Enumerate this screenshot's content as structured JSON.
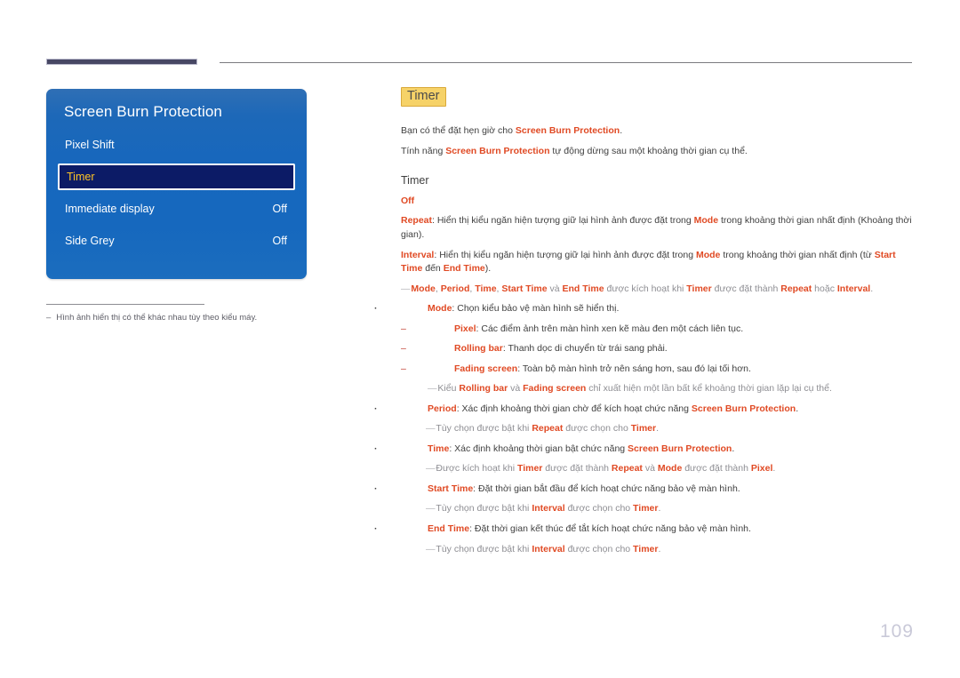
{
  "page": {
    "number": "109"
  },
  "header": {
    "rule_color": "#474764",
    "thin_rule_color": "#7a7a7f"
  },
  "osd": {
    "title": "Screen Burn Protection",
    "rows": [
      {
        "label": "Pixel Shift",
        "value": ""
      },
      {
        "label": "Timer",
        "value": "",
        "selected": true
      },
      {
        "label": "Immediate display",
        "value": "Off"
      },
      {
        "label": "Side Grey",
        "value": "Off"
      }
    ],
    "footnote_dash": "–",
    "footnote": "Hình ảnh hiển thị có thể khác nhau tùy theo kiểu máy.",
    "accent_selected_text": "#ffc425",
    "panel_blue": "#1767bd",
    "selected_bg": "#0c1b66"
  },
  "content": {
    "title_badge": "Timer",
    "intro": [
      {
        "parts": [
          {
            "t": "Bạn có thể đặt hẹn giờ cho ",
            "s": "n"
          },
          {
            "t": "Screen Burn Protection",
            "s": "k"
          },
          {
            "t": ".",
            "s": "n"
          }
        ]
      },
      {
        "parts": [
          {
            "t": "Tính năng ",
            "s": "n"
          },
          {
            "t": "Screen Burn Protection",
            "s": "k"
          },
          {
            "t": " tự động dừng sau một khoảng thời gian cụ thể.",
            "s": "n"
          }
        ]
      }
    ],
    "sub_heading": "Timer",
    "lines": [
      {
        "level": "plain",
        "parts": [
          {
            "t": "Off",
            "s": "k"
          }
        ]
      },
      {
        "level": "plain",
        "parts": [
          {
            "t": "Repeat",
            "s": "k"
          },
          {
            "t": ": Hiển thị kiểu ngăn hiện tượng giữ lại hình ảnh được đặt trong ",
            "s": "n"
          },
          {
            "t": "Mode",
            "s": "k"
          },
          {
            "t": " trong khoảng thời gian nhất định (Khoảng thời gian).",
            "s": "n"
          }
        ]
      },
      {
        "level": "plain",
        "parts": [
          {
            "t": "Interval",
            "s": "k"
          },
          {
            "t": ": Hiển thị kiểu ngăn hiện tượng giữ lại hình ảnh được đặt trong ",
            "s": "n"
          },
          {
            "t": "Mode",
            "s": "k"
          },
          {
            "t": " trong khoảng thời gian nhất định (từ ",
            "s": "n"
          },
          {
            "t": "Start Time",
            "s": "k"
          },
          {
            "t": " đến ",
            "s": "n"
          },
          {
            "t": "End Time",
            "s": "k"
          },
          {
            "t": ").",
            "s": "n"
          }
        ]
      },
      {
        "level": "note",
        "parts": [
          {
            "t": "Mode",
            "s": "k"
          },
          {
            "t": ", ",
            "s": "m"
          },
          {
            "t": "Period",
            "s": "k"
          },
          {
            "t": ", ",
            "s": "m"
          },
          {
            "t": "Time",
            "s": "k"
          },
          {
            "t": ", ",
            "s": "m"
          },
          {
            "t": "Start Time",
            "s": "k"
          },
          {
            "t": " và ",
            "s": "m"
          },
          {
            "t": "End Time",
            "s": "k"
          },
          {
            "t": " được kích hoạt khi ",
            "s": "m"
          },
          {
            "t": "Timer",
            "s": "k"
          },
          {
            "t": " được đặt thành ",
            "s": "m"
          },
          {
            "t": "Repeat",
            "s": "k"
          },
          {
            "t": " hoặc ",
            "s": "m"
          },
          {
            "t": "Interval",
            "s": "k"
          },
          {
            "t": ".",
            "s": "m"
          }
        ]
      },
      {
        "level": "bullet",
        "parts": [
          {
            "t": "Mode",
            "s": "k"
          },
          {
            "t": ": Chọn kiểu bảo vệ màn hình sẽ hiển thị.",
            "s": "n"
          }
        ]
      },
      {
        "level": "dash",
        "parts": [
          {
            "t": "Pixel",
            "s": "k"
          },
          {
            "t": ": Các điểm ảnh trên màn hình xen kẽ màu đen một cách liên tục.",
            "s": "n"
          }
        ]
      },
      {
        "level": "dash",
        "parts": [
          {
            "t": "Rolling bar",
            "s": "k"
          },
          {
            "t": ": Thanh dọc di chuyển từ trái sang phải.",
            "s": "n"
          }
        ]
      },
      {
        "level": "dash",
        "parts": [
          {
            "t": "Fading screen",
            "s": "k"
          },
          {
            "t": ": Toàn bộ màn hình trở nên sáng hơn, sau đó lại tối hơn.",
            "s": "n"
          }
        ]
      },
      {
        "level": "note2",
        "parts": [
          {
            "t": "Kiểu ",
            "s": "m"
          },
          {
            "t": "Rolling bar",
            "s": "k"
          },
          {
            "t": " và ",
            "s": "m"
          },
          {
            "t": "Fading screen",
            "s": "k"
          },
          {
            "t": " chỉ xuất hiện một lần bất kể khoảng thời gian lặp lại cụ thể.",
            "s": "m"
          }
        ]
      },
      {
        "level": "bullet",
        "parts": [
          {
            "t": "Period",
            "s": "k"
          },
          {
            "t": ": Xác định khoảng thời gian chờ để kích hoạt chức năng ",
            "s": "n"
          },
          {
            "t": "Screen Burn Protection",
            "s": "k"
          },
          {
            "t": ".",
            "s": "n"
          }
        ]
      },
      {
        "level": "note3",
        "parts": [
          {
            "t": "Tùy chọn được bật khi ",
            "s": "m"
          },
          {
            "t": "Repeat",
            "s": "k"
          },
          {
            "t": " được chọn cho ",
            "s": "m"
          },
          {
            "t": "Timer",
            "s": "k"
          },
          {
            "t": ".",
            "s": "m"
          }
        ]
      },
      {
        "level": "bullet",
        "parts": [
          {
            "t": "Time",
            "s": "k"
          },
          {
            "t": ": Xác định khoảng thời gian bật chức năng ",
            "s": "n"
          },
          {
            "t": "Screen Burn Protection",
            "s": "k"
          },
          {
            "t": ".",
            "s": "n"
          }
        ]
      },
      {
        "level": "note3",
        "parts": [
          {
            "t": "Được kích hoạt khi ",
            "s": "m"
          },
          {
            "t": "Timer",
            "s": "k"
          },
          {
            "t": " được đặt thành ",
            "s": "m"
          },
          {
            "t": "Repeat",
            "s": "k"
          },
          {
            "t": " và ",
            "s": "m"
          },
          {
            "t": "Mode",
            "s": "k"
          },
          {
            "t": " được đặt thành ",
            "s": "m"
          },
          {
            "t": "Pixel",
            "s": "k"
          },
          {
            "t": ".",
            "s": "m"
          }
        ]
      },
      {
        "level": "bullet",
        "parts": [
          {
            "t": "Start Time",
            "s": "k"
          },
          {
            "t": ": Đặt thời gian bắt đầu để kích hoạt chức năng bảo vệ màn hình.",
            "s": "n"
          }
        ]
      },
      {
        "level": "note3",
        "parts": [
          {
            "t": "Tùy chọn được bật khi ",
            "s": "m"
          },
          {
            "t": "Interval",
            "s": "k"
          },
          {
            "t": " được chọn cho ",
            "s": "m"
          },
          {
            "t": "Timer",
            "s": "k"
          },
          {
            "t": ".",
            "s": "m"
          }
        ]
      },
      {
        "level": "bullet",
        "parts": [
          {
            "t": "End Time",
            "s": "k"
          },
          {
            "t": ": Đặt thời gian kết thúc để tắt kích hoạt chức năng bảo vệ màn hình.",
            "s": "n"
          }
        ]
      },
      {
        "level": "note3",
        "parts": [
          {
            "t": "Tùy chọn được bật khi ",
            "s": "m"
          },
          {
            "t": "Interval",
            "s": "k"
          },
          {
            "t": " được chọn cho ",
            "s": "m"
          },
          {
            "t": "Timer",
            "s": "k"
          },
          {
            "t": ".",
            "s": "m"
          }
        ]
      }
    ]
  },
  "colors": {
    "keyword": "#e04a24",
    "body_text": "#3f3f3f",
    "note_text": "#8e8e93",
    "badge_bg": "#f6d268",
    "badge_border": "#d9a93a",
    "page_number": "#c9c9d8"
  }
}
